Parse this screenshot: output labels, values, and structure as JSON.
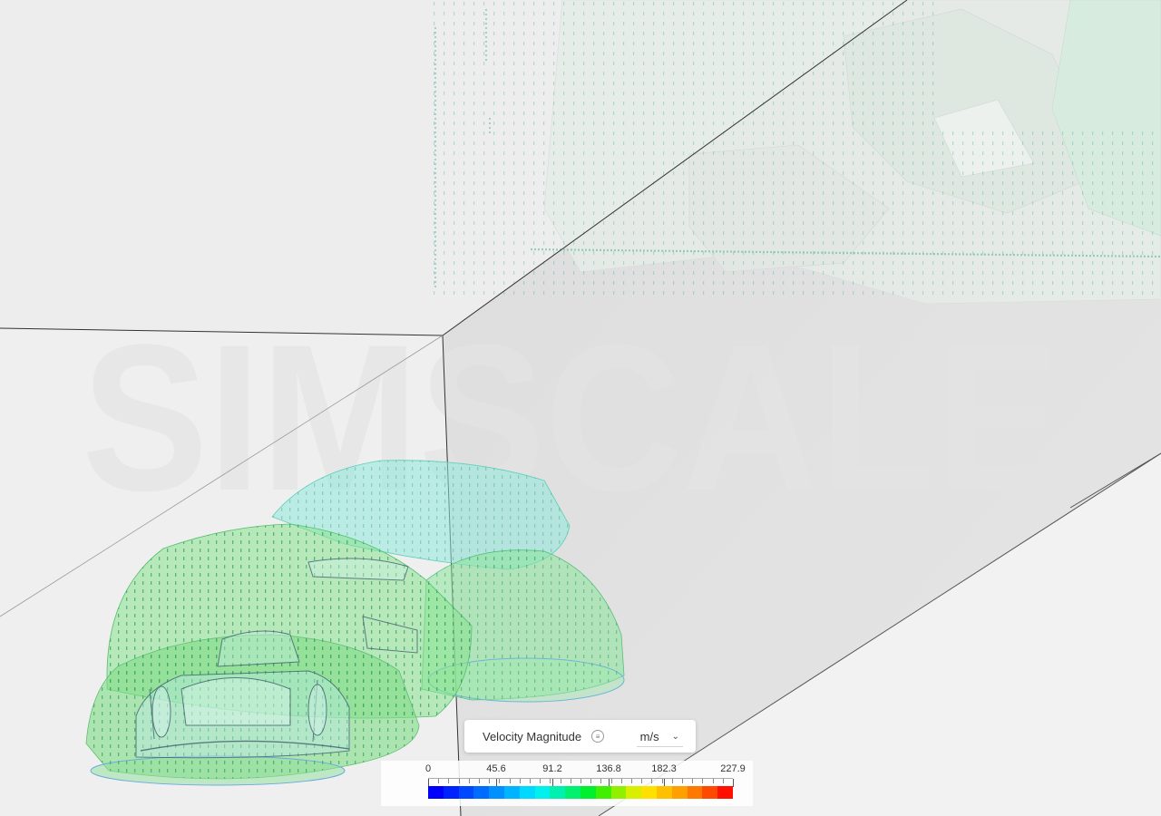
{
  "viewer": {
    "watermark": "SIMSCALE"
  },
  "legend": {
    "field": "Velocity Magnitude",
    "unit": "m/s",
    "menu_icon": "hamburger-circle-icon",
    "dropdown_icon": "chevron-down-icon",
    "ticks": [
      "0",
      "45.6",
      "91.2",
      "136.8",
      "182.3",
      "227.9"
    ],
    "colormap": [
      "#0000ff",
      "#0022ff",
      "#0048ff",
      "#006cff",
      "#0090ff",
      "#00b4ff",
      "#00d8ff",
      "#00f0ee",
      "#00f0b0",
      "#00f070",
      "#00f030",
      "#40f000",
      "#90f000",
      "#d8f000",
      "#ffe000",
      "#ffc000",
      "#ffa000",
      "#ff7800",
      "#ff4800",
      "#ff1000"
    ]
  },
  "colors": {
    "background": "#f2f2f2",
    "domain_edge": "#333333",
    "surface_green": "#7fe08a",
    "surface_cyan": "#8fe8e0"
  }
}
